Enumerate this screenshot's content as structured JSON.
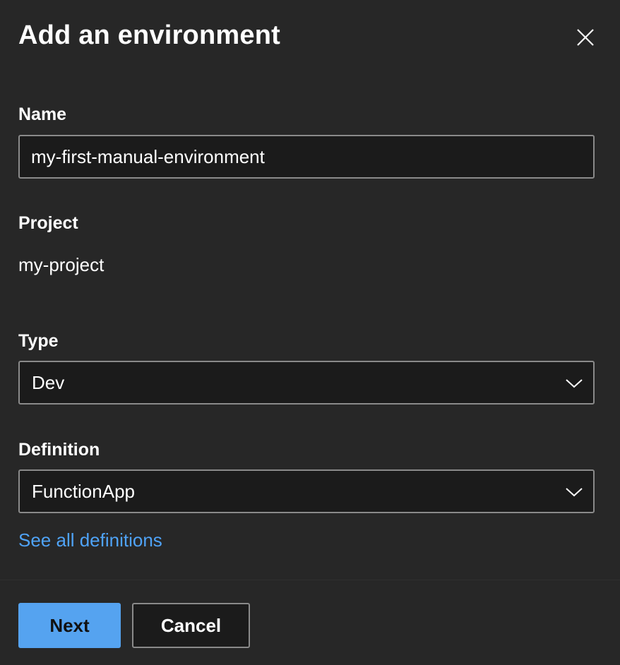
{
  "dialog": {
    "title": "Add an environment",
    "close_icon": "close-icon"
  },
  "fields": {
    "name": {
      "label": "Name",
      "value": "my-first-manual-environment"
    },
    "project": {
      "label": "Project",
      "value": "my-project"
    },
    "type": {
      "label": "Type",
      "selected": "Dev",
      "icon": "chevron-down-icon"
    },
    "definition": {
      "label": "Definition",
      "selected": "FunctionApp",
      "icon": "chevron-down-icon"
    }
  },
  "links": {
    "see_all_definitions": "See all definitions"
  },
  "footer": {
    "next_label": "Next",
    "cancel_label": "Cancel"
  },
  "colors": {
    "background": "#272727",
    "input_background": "#1b1b1b",
    "border": "#8a8a8a",
    "link": "#4fa3f7",
    "primary_button": "#55a3f0"
  }
}
